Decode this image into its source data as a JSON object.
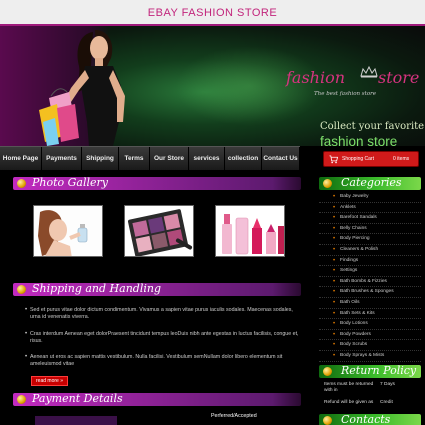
{
  "store_title": "EBAY FASHION STORE",
  "banner": {
    "logo_word1": "fashion",
    "logo_word2": "store",
    "logo_tag": "The best fashion store",
    "tagline1": "Collect your favorite",
    "tagline2": "fashion store"
  },
  "nav": {
    "items": [
      "Home Page",
      "Payments",
      "Shipping",
      "Terms",
      "Our Store",
      "services",
      "collection",
      "Contact Us"
    ]
  },
  "cart": {
    "label": "Shopping Cart",
    "count": "0 items"
  },
  "sections": {
    "gallery": "Photo Gallery",
    "shipping": "Shipping and Handling",
    "payment": "Payment Details"
  },
  "bullets": [
    "Sed et purus vitae dolor dictum condimentum. Vivamus a sapien vitae purus iaculis sodales. Maecenas sodales, urna id venenatis viverra.",
    "Cras interdum Aenean eget dolorPraesent tincidunt tempus leoDuis nibh ante egestas in luctus facilisis, congue et, risus.",
    "Aenean ut eros ac sapien mattis vestibulum. Nulla facilisi. Vestibulum semNullam dolor libero elementum sit ameleuismod vitae"
  ],
  "read_more": "read more »",
  "payment_label": "Perferred/Accepted",
  "sidebar": {
    "categories_title": "Categories",
    "categories": [
      "Baby Jewelry",
      "Anklets",
      "Barefoot Sandals",
      "Belly Chains",
      "Body Piercing",
      "Cleaners & Polish",
      "Findings",
      "Settings",
      "Bath Bombs & Fizzies",
      "Bath Brushes & Sponges",
      "Bath Oils",
      "Bath Sets & Kits",
      "Body Lotions",
      "Body Powders",
      "Body Scrubs",
      "Body Sprays & Mists"
    ],
    "return_title": "Return Policy",
    "return_rows": [
      {
        "key": "Items must be returned with in",
        "value": "7 Days"
      },
      {
        "key": "Refund will be given as",
        "value": "Credit"
      }
    ],
    "contacts_title": "Contacts"
  },
  "colors": {
    "accent_magenta": "#c22ac0",
    "accent_green": "#3bbb2b",
    "title_pink": "#c2257c",
    "cart_red": "#d01a1a"
  }
}
